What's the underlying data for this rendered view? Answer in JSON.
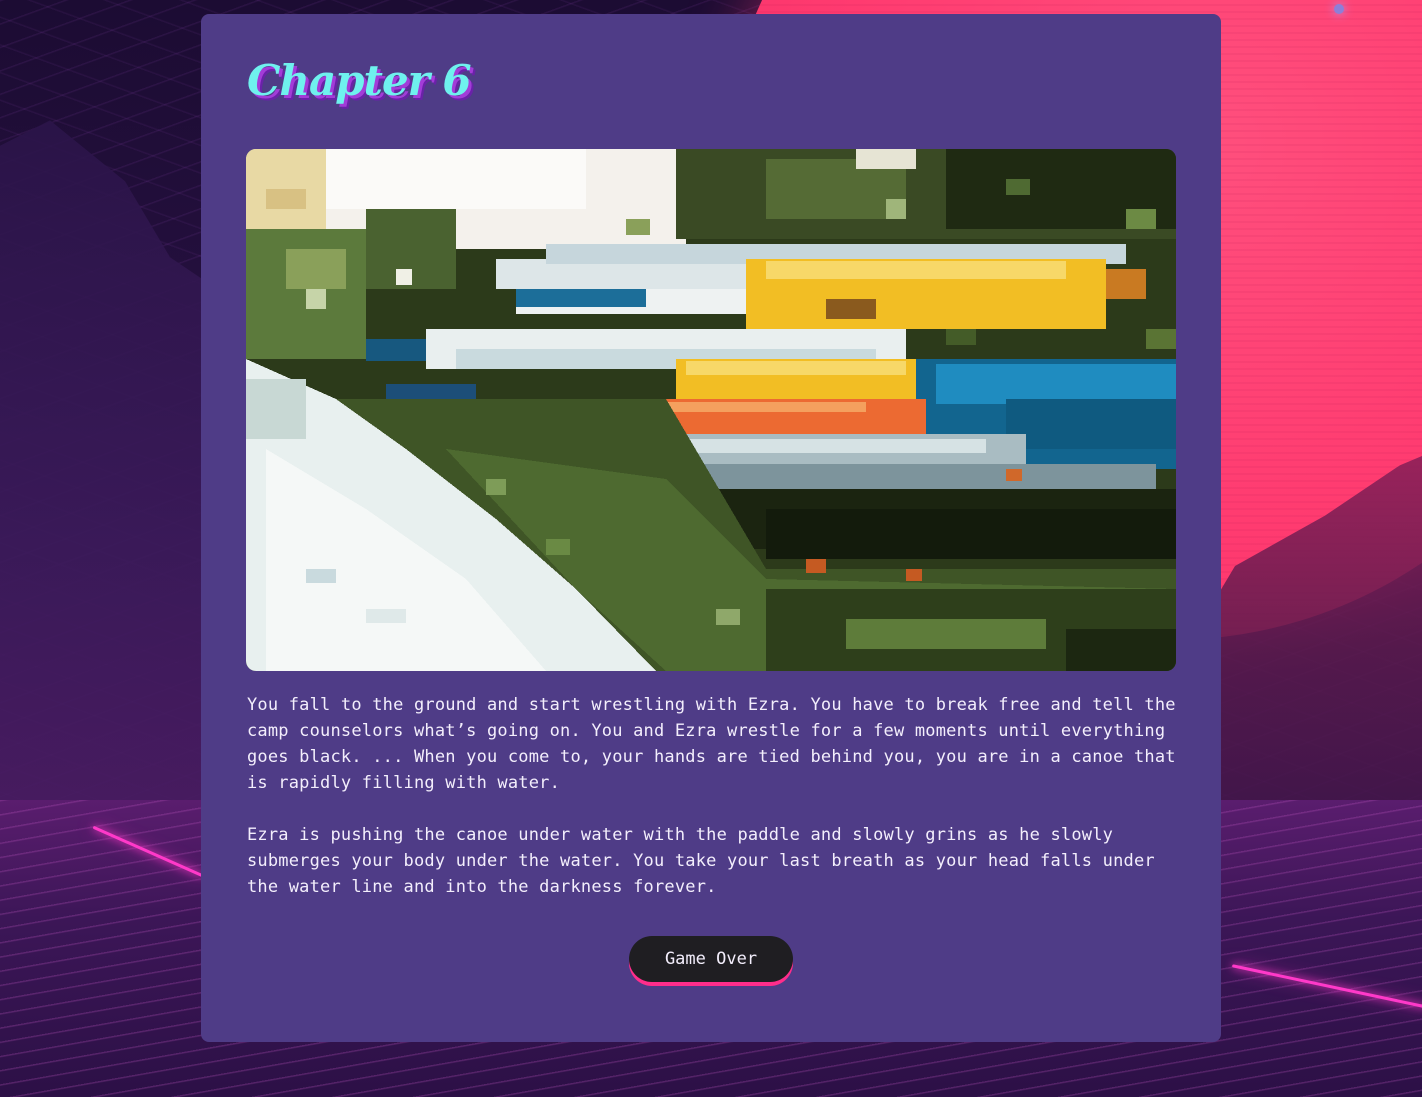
{
  "chapter": {
    "title": "Chapter 6"
  },
  "scene_image": {
    "alt": "Pixelated canoes on rack"
  },
  "story": {
    "paragraphs": [
      "You fall to the ground and start wrestling with Ezra. You have to break free and tell the camp counselors what’s going on. You and Ezra wrestle for a few moments until everything goes black. ... When you come to, your hands are tied behind you, you are in a canoe that is rapidly filling with water.",
      "Ezra is pushing the canoe under water with the paddle and slowly grins as he slowly submerges your body under the water. You take your last breath as your head falls under the water line and into the darkness forever."
    ]
  },
  "actions": {
    "game_over_label": "Game Over"
  },
  "colors": {
    "card": "#4f3c87",
    "title": "#6ff1ee",
    "title_shadow": "#a23cd8",
    "button_bg": "#1f1e22",
    "button_accent": "#ff2d8b",
    "sun": "#ff3b70"
  }
}
